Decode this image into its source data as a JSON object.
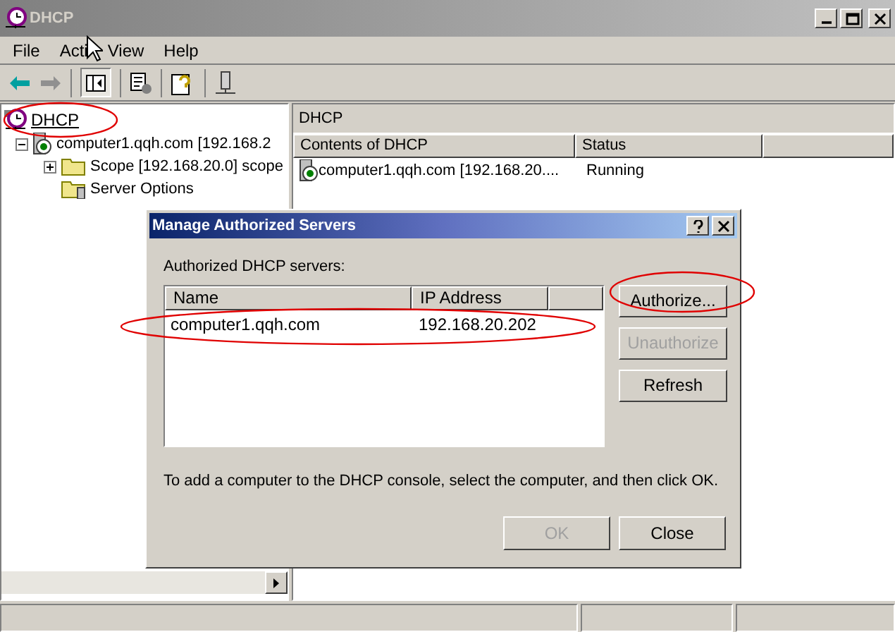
{
  "window": {
    "title": "DHCP"
  },
  "menu": [
    {
      "label": "File"
    },
    {
      "label": "Acti"
    },
    {
      "label": "View"
    },
    {
      "label": "Help"
    }
  ],
  "tree": {
    "label": "DHCP",
    "children": [
      {
        "label": "computer1.qqh.com [192.168.2",
        "kind": "server",
        "expanded": true,
        "children": [
          {
            "label": "Scope [192.168.20.0] scope",
            "kind": "scope",
            "expanded": false
          },
          {
            "label": "Server Options",
            "kind": "options"
          }
        ]
      }
    ]
  },
  "content": {
    "header": "DHCP",
    "columns": [
      "Contents of DHCP",
      "Status"
    ],
    "rows": [
      {
        "cells": [
          "computer1.qqh.com [192.168.20....",
          "Running"
        ]
      }
    ]
  },
  "dialog": {
    "title": "Manage Authorized Servers",
    "list_label": "Authorized DHCP servers:",
    "columns": [
      "Name",
      "IP Address"
    ],
    "rows": [
      {
        "cells": [
          "computer1.qqh.com",
          "192.168.20.202"
        ]
      }
    ],
    "buttons": [
      {
        "label": "Authorize...",
        "disabled": false
      },
      {
        "label": "Unauthorize",
        "disabled": true
      },
      {
        "label": "Refresh",
        "disabled": false
      }
    ],
    "hint": "To add a computer to the DHCP console, select the computer, and then click OK.",
    "footer_buttons": [
      {
        "label": "OK",
        "disabled": true
      },
      {
        "label": "Close",
        "disabled": false
      }
    ]
  }
}
